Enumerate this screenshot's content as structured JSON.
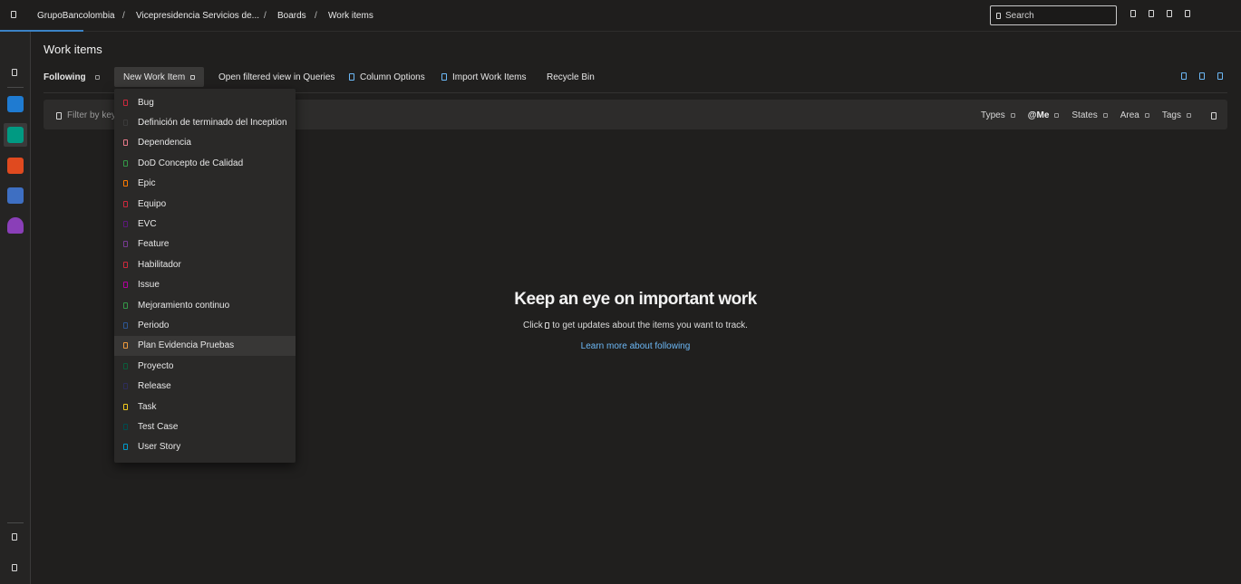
{
  "breadcrumb": {
    "org": "GrupoBancolombia",
    "project": "Vicepresidencia Servicios de...",
    "section": "Boards",
    "page": "Work items"
  },
  "search": {
    "placeholder": "Search"
  },
  "page": {
    "title": "Work items"
  },
  "toolbar": {
    "view_label": "Following",
    "new_work_item": "New Work Item",
    "open_in_queries": "Open filtered view in Queries",
    "column_options": "Column Options",
    "import_work_items": "Import Work Items",
    "recycle_bin": "Recycle Bin"
  },
  "filter": {
    "placeholder": "Filter by keyword",
    "pills": [
      "Types",
      "@Me",
      "States",
      "Area",
      "Tags"
    ]
  },
  "empty_state": {
    "title": "Keep an eye on important work",
    "sub_before": "Click",
    "sub_after": "to get updates about the items you want to track.",
    "link": "Learn more about following"
  },
  "menu": {
    "items": [
      {
        "label": "Bug",
        "color": "#cc293d"
      },
      {
        "label": "Definición de terminado del Inception",
        "color": "#3a3a3a"
      },
      {
        "label": "Dependencia",
        "color": "#e87a8a"
      },
      {
        "label": "DoD Concepto de Calidad",
        "color": "#339947"
      },
      {
        "label": "Epic",
        "color": "#ff7b00"
      },
      {
        "label": "Equipo",
        "color": "#cc293d"
      },
      {
        "label": "EVC",
        "color": "#5c197b"
      },
      {
        "label": "Feature",
        "color": "#773b93"
      },
      {
        "label": "Habilitador",
        "color": "#cc293d"
      },
      {
        "label": "Issue",
        "color": "#b4009e"
      },
      {
        "label": "Mejoramiento continuo",
        "color": "#339947"
      },
      {
        "label": "Periodo",
        "color": "#2b5797"
      },
      {
        "label": "Plan Evidencia Pruebas",
        "color": "#f29b3a"
      },
      {
        "label": "Proyecto",
        "color": "#0b5c3c"
      },
      {
        "label": "Release",
        "color": "#2d2d5a"
      },
      {
        "label": "Task",
        "color": "#f2cb1d"
      },
      {
        "label": "Test Case",
        "color": "#004b50"
      },
      {
        "label": "User Story",
        "color": "#009ccc"
      }
    ],
    "hovered_index": 12
  }
}
